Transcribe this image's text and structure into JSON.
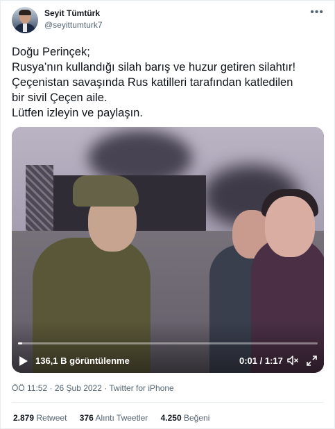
{
  "author": {
    "display_name": "Seyit Tümtürk",
    "handle": "@seyittumturk7"
  },
  "tweet": {
    "lines": [
      "Doğu Perinçek;",
      "Rusya’nın kullandığı silah barış ve huzur getiren silahtır!",
      "Çeçenistan savaşında Rus katilleri tarafından katledilen",
      "bir sivil Çeçen aile.",
      "Lütfen izleyin ve paylaşın."
    ]
  },
  "video": {
    "views_label": "136,1 B görüntülenme",
    "time_label": "0:01 / 1:17",
    "progress_fraction": 0.013
  },
  "meta": {
    "time": "ÖÖ 11:52",
    "separator": "·",
    "date": "26 Şub 2022",
    "source": "Twitter for iPhone"
  },
  "stats": {
    "retweets_count": "2.879",
    "retweets_label": "Retweet",
    "quotes_count": "376",
    "quotes_label": "Alıntı Tweetler",
    "likes_count": "4.250",
    "likes_label": "Beğeni"
  },
  "icons": {
    "more": "more-icon",
    "play": "play-icon",
    "volume": "volume-icon",
    "fullscreen": "fullscreen-icon"
  }
}
